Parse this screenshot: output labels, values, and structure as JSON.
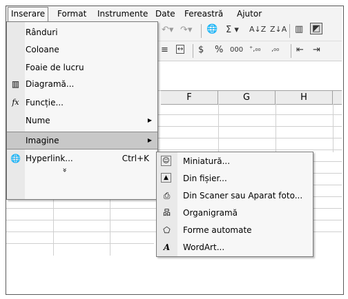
{
  "menubar": {
    "items": [
      {
        "label": "Inserare",
        "accel": "I"
      },
      {
        "label": "Format",
        "accel": "o"
      },
      {
        "label": "Instrumente",
        "accel": "u"
      },
      {
        "label": "Date",
        "accel": "D"
      },
      {
        "label": "Fereastră",
        "accel": "e"
      },
      {
        "label": "Ajutor",
        "accel": "A"
      }
    ]
  },
  "toolbar": {
    "sigma": "Σ",
    "percent": "%",
    "thousands": "000",
    "inc_decimal": "⁺,₀₀",
    "dec_decimal": ",₀₀"
  },
  "columns": [
    "F",
    "G",
    "H"
  ],
  "insert_menu": {
    "items": [
      {
        "label": "Rânduri",
        "icon": "none"
      },
      {
        "label": "Coloane",
        "icon": "none"
      },
      {
        "label": "Foaie de lucru",
        "icon": "none"
      },
      {
        "label": "Diagramă...",
        "icon": "chart-icon"
      },
      {
        "label": "Funcție...",
        "icon": "function-icon",
        "icon_text": "fx"
      },
      {
        "label": "Nume",
        "icon": "none",
        "submenu": true
      },
      {
        "label": "Imagine",
        "icon": "none",
        "submenu": true,
        "highlighted": true
      },
      {
        "label": "Hyperlink...",
        "icon": "hyperlink-icon",
        "shortcut": "Ctrl+K"
      }
    ],
    "more": "»"
  },
  "image_submenu": {
    "items": [
      {
        "label": "Miniatură...",
        "icon": "clipart-icon"
      },
      {
        "label": "Din fișier...",
        "icon": "picture-file-icon"
      },
      {
        "label": "Din Scaner sau Aparat foto...",
        "icon": "scanner-icon"
      },
      {
        "label": "Organigramă",
        "icon": "org-chart-icon"
      },
      {
        "label": "Forme automate",
        "icon": "autoshapes-icon"
      },
      {
        "label": "WordArt...",
        "icon": "wordart-icon"
      }
    ]
  }
}
